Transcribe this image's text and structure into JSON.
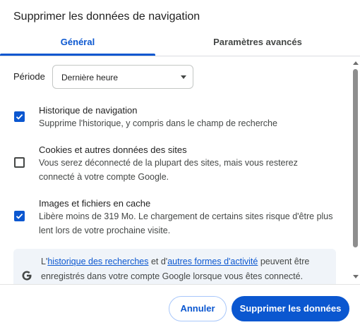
{
  "dialog": {
    "title": "Supprimer les données de navigation"
  },
  "tabs": [
    {
      "label": "Général",
      "active": true
    },
    {
      "label": "Paramètres avancés",
      "active": false
    }
  ],
  "period": {
    "label": "Période",
    "selected": "Dernière heure"
  },
  "options": [
    {
      "title": "Historique de navigation",
      "description": "Supprime l'historique, y compris dans le champ de recherche",
      "checked": true
    },
    {
      "title": "Cookies et autres données des sites",
      "description": "Vous serez déconnecté de la plupart des sites, mais vous resterez connecté à votre compte Google.",
      "checked": false
    },
    {
      "title": "Images et fichiers en cache",
      "description": "Libère moins de 319 Mo. Le chargement de certains sites risque d'être plus lent lors de votre prochaine visite.",
      "checked": true
    }
  ],
  "info": {
    "prefix": "L'",
    "link1": "historique des recherches",
    "middle": " et d'",
    "link2": "autres formes d'activité",
    "suffix": " peuvent être enregistrés dans votre compte Google lorsque vous êtes connecté.",
    "icon": "google-g-icon"
  },
  "buttons": {
    "cancel": "Annuler",
    "delete": "Supprimer les données"
  },
  "colors": {
    "accent": "#0b57d0",
    "info_bg": "#f0f4f9"
  }
}
